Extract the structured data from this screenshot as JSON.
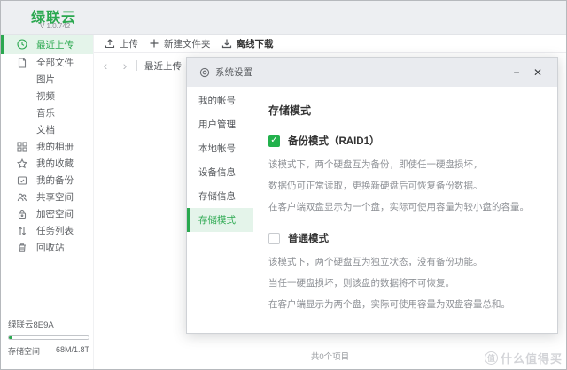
{
  "app": {
    "logo": "绿联云",
    "version": "V 1.0.742"
  },
  "toolbar": {
    "upload": "上传",
    "new_folder": "新建文件夹",
    "offline_download": "离线下载"
  },
  "breadcrumb": {
    "back": "‹",
    "forward": "›",
    "label": "最近上传"
  },
  "sidebar": {
    "items": [
      {
        "label": "最近上传",
        "icon": "clock-icon",
        "active": true
      },
      {
        "label": "全部文件",
        "icon": "file-icon"
      },
      {
        "label": "图片",
        "indent": true
      },
      {
        "label": "视频",
        "indent": true
      },
      {
        "label": "音乐",
        "indent": true
      },
      {
        "label": "文档",
        "indent": true
      },
      {
        "label": "我的相册",
        "icon": "grid-icon"
      },
      {
        "label": "我的收藏",
        "icon": "star-icon"
      },
      {
        "label": "我的备份",
        "icon": "backup-icon"
      },
      {
        "label": "共享空间",
        "icon": "people-icon"
      },
      {
        "label": "加密空间",
        "icon": "lock-icon"
      },
      {
        "label": "任务列表",
        "icon": "tasks-icon"
      },
      {
        "label": "回收站",
        "icon": "trash-icon"
      }
    ],
    "device": {
      "name": "绿联云8E9A",
      "storage_label": "存储空间",
      "storage_value": "68M/1.8T"
    }
  },
  "dialog": {
    "title": "系统设置",
    "minimize": "−",
    "close": "✕",
    "menu": [
      {
        "label": "我的帐号"
      },
      {
        "label": "用户管理"
      },
      {
        "label": "本地帐号"
      },
      {
        "label": "设备信息"
      },
      {
        "label": "存储信息"
      },
      {
        "label": "存储模式",
        "active": true
      }
    ],
    "content": {
      "title": "存储模式",
      "modes": [
        {
          "label": "备份模式（RAID1）",
          "checked": true,
          "descriptions": [
            "该模式下，两个硬盘互为备份，即使任一硬盘损坏，",
            "数据仍可正常读取，更换新硬盘后可恢复备份数据。",
            "在客户端双盘显示为一个盘，实际可使用容量为较小盘的容量。"
          ]
        },
        {
          "label": "普通模式",
          "checked": false,
          "descriptions": [
            "该模式下，两个硬盘互为独立状态，没有备份功能。",
            "当任一硬盘损坏，则该盘的数据将不可恢复。",
            "在客户端显示为两个盘，实际可使用容量为双盘容量总和。"
          ]
        }
      ]
    }
  },
  "statusbar": {
    "items_count": "共0个项目"
  },
  "watermark": {
    "icon_char": "值",
    "text": "什么值得买"
  },
  "colors": {
    "accent": "#2aa84f",
    "accent_bg": "#e4f4ea",
    "checkbox_green": "#22b14c"
  }
}
